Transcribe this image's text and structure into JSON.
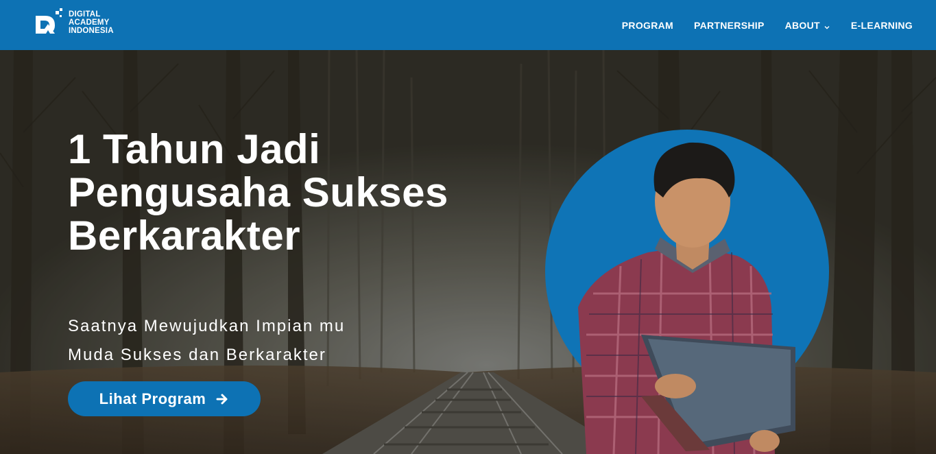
{
  "brand": {
    "name_line1": "DIGITAL",
    "name_line2": "ACADEMY",
    "name_line3": "INDONESIA",
    "logo_icon": "da-logo-icon"
  },
  "nav": {
    "items": [
      {
        "label": "PROGRAM"
      },
      {
        "label": "PARTNERSHIP"
      },
      {
        "label": "ABOUT",
        "has_dropdown": true
      },
      {
        "label": "E-LEARNING"
      }
    ]
  },
  "hero": {
    "headline_line1": "1 Tahun Jadi",
    "headline_line2": "Pengusaha Sukses",
    "headline_line3": "Berkarakter",
    "subline_line1": "Saatnya Mewujudkan Impian mu",
    "subline_line2": "Muda Sukses dan Berkarakter",
    "cta_label": "Lihat Program",
    "cta_icon": "arrow-right-icon"
  },
  "colors": {
    "brand_blue": "#0d72b4",
    "text_white": "#ffffff"
  }
}
